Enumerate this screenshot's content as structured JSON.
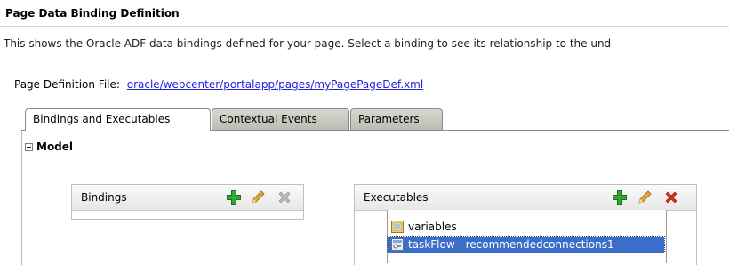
{
  "header": {
    "title": "Page Data Binding Definition",
    "description": "This shows the Oracle ADF data bindings defined for your page. Select a binding to see its relationship to the und"
  },
  "page_definition": {
    "label": "Page Definition File:",
    "link_text": "oracle/webcenter/portalapp/pages/myPagePageDef.xml"
  },
  "tabs": [
    {
      "label": "Bindings and Executables",
      "active": true
    },
    {
      "label": "Contextual Events",
      "active": false
    },
    {
      "label": "Parameters",
      "active": false
    }
  ],
  "model": {
    "title": "Model"
  },
  "bindings_panel": {
    "title": "Bindings",
    "icons": [
      "add-icon",
      "edit-icon",
      "delete-icon-disabled"
    ]
  },
  "executables_panel": {
    "title": "Executables",
    "icons": [
      "add-icon",
      "edit-icon",
      "delete-icon"
    ],
    "items": [
      {
        "label": "variables",
        "icon": "variables-icon",
        "selected": false
      },
      {
        "label": "taskFlow - recommendedconnections1",
        "icon": "taskflow-icon",
        "selected": true
      }
    ]
  },
  "colors": {
    "link": "#2222dd",
    "selection": "#3a6ec8",
    "add_icon": "#2f9a2f",
    "delete_icon": "#d9261c",
    "inactive_tab": "#c9ccc2"
  }
}
